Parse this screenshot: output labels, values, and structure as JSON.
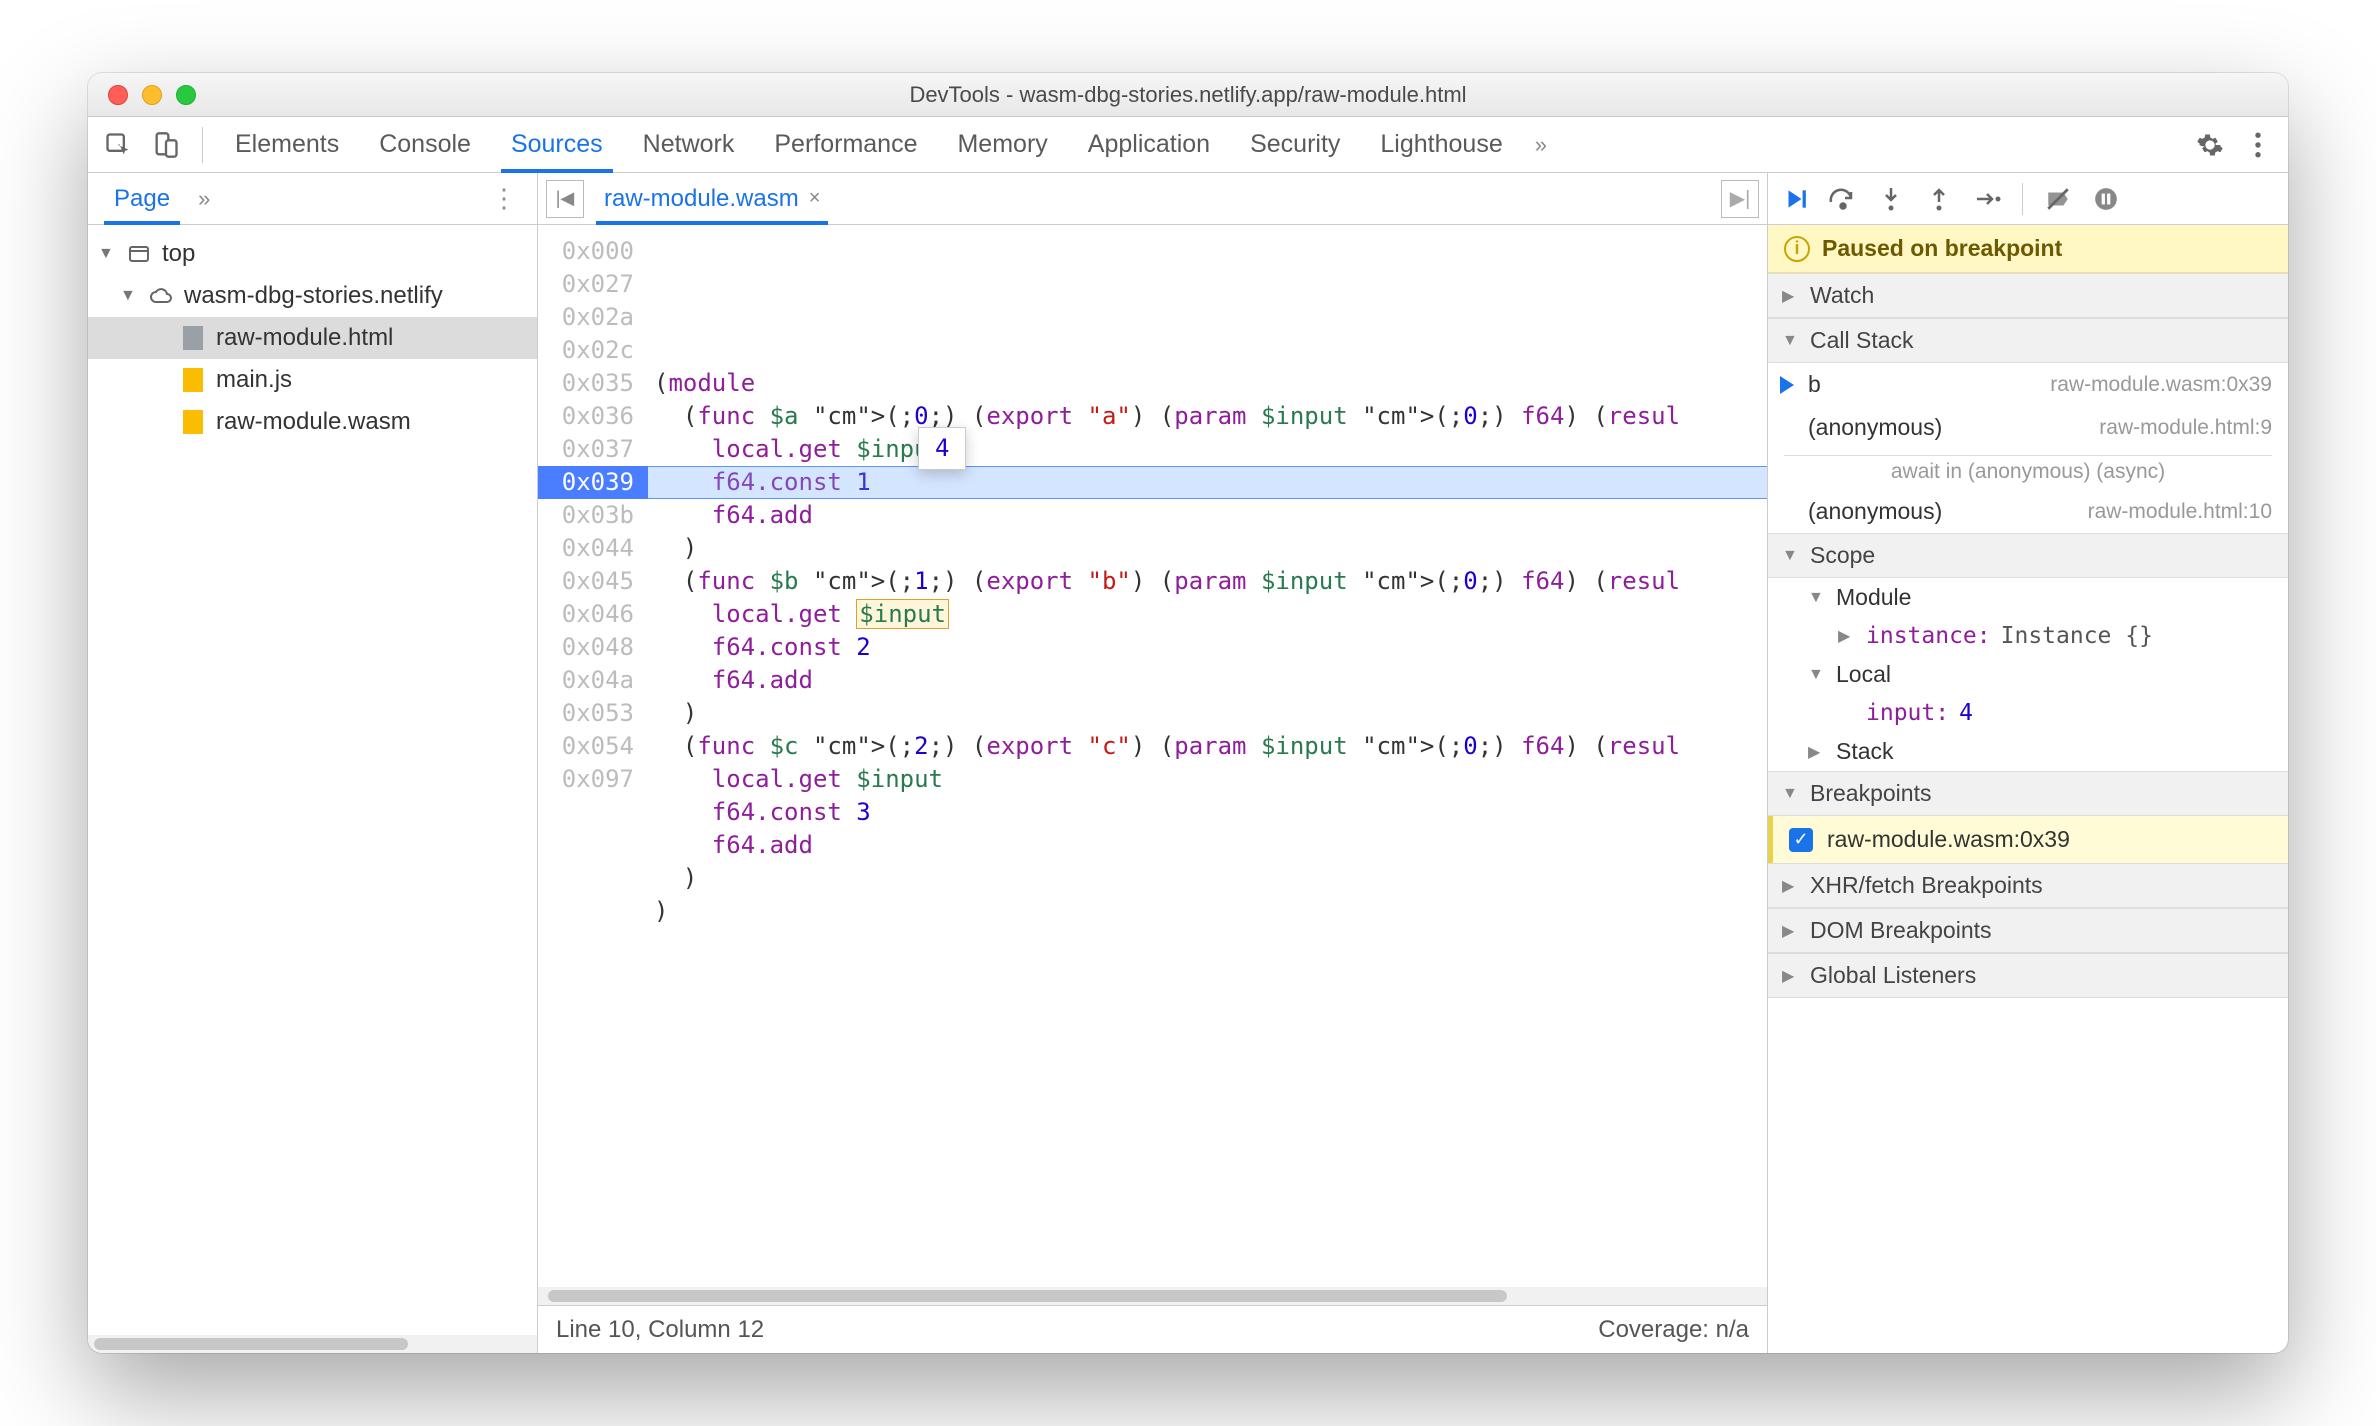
{
  "window_title": "DevTools - wasm-dbg-stories.netlify.app/raw-module.html",
  "main_tabs": [
    "Elements",
    "Console",
    "Sources",
    "Network",
    "Performance",
    "Memory",
    "Application",
    "Security",
    "Lighthouse"
  ],
  "main_tab_active": "Sources",
  "nav": {
    "tab": "Page",
    "tree": {
      "top": "top",
      "domain": "wasm-dbg-stories.netlify",
      "files": [
        "raw-module.html",
        "main.js",
        "raw-module.wasm"
      ],
      "selected": "raw-module.html"
    }
  },
  "editor": {
    "tab": "raw-module.wasm",
    "addresses": [
      "0x000",
      "0x027",
      "0x02a",
      "0x02c",
      "0x035",
      "0x036",
      "0x037",
      "0x039",
      "0x03b",
      "0x044",
      "0x045",
      "0x046",
      "0x048",
      "0x04a",
      "0x053",
      "0x054",
      "0x097"
    ],
    "highlight_index": 7,
    "tooltip_value": "4",
    "code_lines": [
      {
        "t": "(module"
      },
      {
        "t": "  (func $a (;0;) (export \"a\") (param $input (;0;) f64) (resul"
      },
      {
        "t": "    local.get $input"
      },
      {
        "t": "    f64.const 1"
      },
      {
        "t": "    f64.add"
      },
      {
        "t": "  )"
      },
      {
        "t": "  (func $b (;1;) (export \"b\") (param $input (;0;) f64) (resul"
      },
      {
        "t": "    local.get $input",
        "hl": true
      },
      {
        "t": "    f64.const 2"
      },
      {
        "t": "    f64.add"
      },
      {
        "t": "  )"
      },
      {
        "t": "  (func $c (;2;) (export \"c\") (param $input (;0;) f64) (resul"
      },
      {
        "t": "    local.get $input"
      },
      {
        "t": "    f64.const 3"
      },
      {
        "t": "    f64.add"
      },
      {
        "t": "  )"
      },
      {
        "t": ")"
      }
    ],
    "status_left": "Line 10, Column 12",
    "status_right": "Coverage: n/a"
  },
  "debugger": {
    "pause_msg": "Paused on breakpoint",
    "watch": "Watch",
    "callstack": "Call Stack",
    "frames": [
      {
        "name": "b",
        "loc": "raw-module.wasm:0x39",
        "current": true
      },
      {
        "name": "(anonymous)",
        "loc": "raw-module.html:9"
      }
    ],
    "async_label": "await in (anonymous) (async)",
    "frames_after": [
      {
        "name": "(anonymous)",
        "loc": "raw-module.html:10"
      }
    ],
    "scope": "Scope",
    "scope_module": "Module",
    "scope_instance_k": "instance:",
    "scope_instance_v": "Instance {}",
    "scope_local": "Local",
    "scope_input_k": "input:",
    "scope_input_v": "4",
    "scope_stack": "Stack",
    "breakpoints": "Breakpoints",
    "bp_item": "raw-module.wasm:0x39",
    "xhr": "XHR/fetch Breakpoints",
    "dom": "DOM Breakpoints",
    "global": "Global Listeners"
  }
}
